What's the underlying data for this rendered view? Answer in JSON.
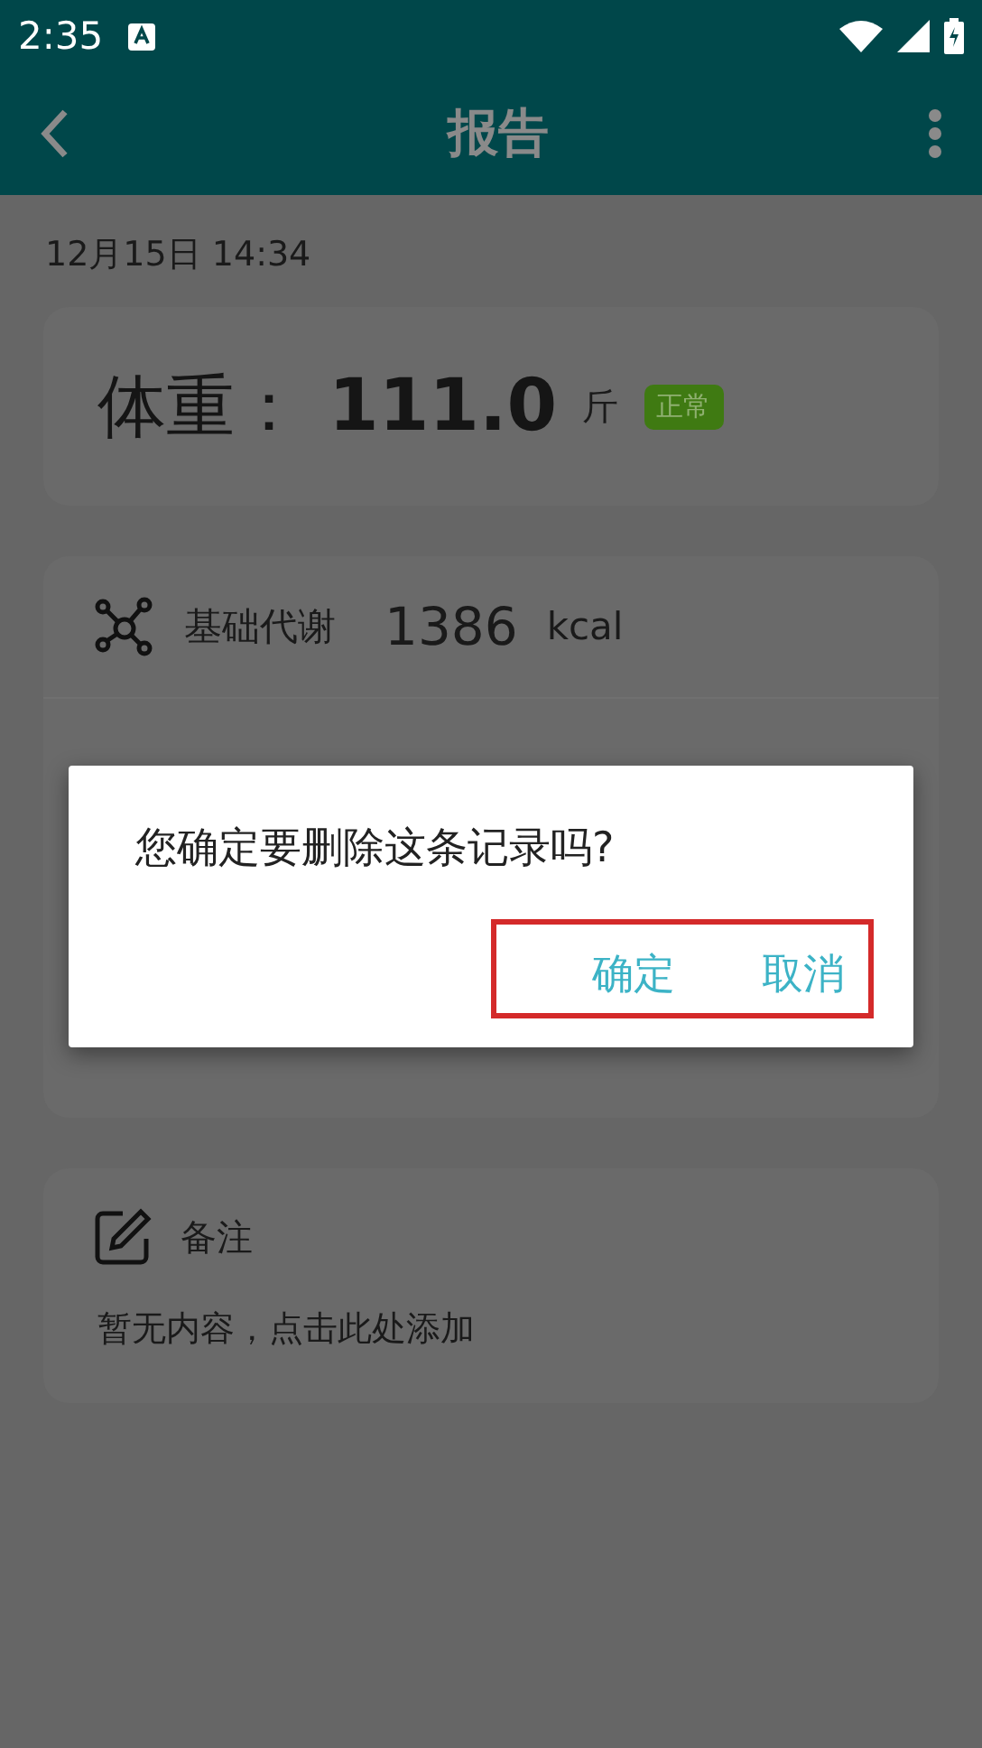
{
  "status_bar": {
    "time": "2:35"
  },
  "app_bar": {
    "title": "报告"
  },
  "date": "12月15日 14:34",
  "weight_card": {
    "label": "体重：",
    "value": "111.0",
    "unit": "斤",
    "badge": "正常"
  },
  "metrics": [
    {
      "kind": "bmr",
      "label": "基础代谢",
      "value": "1386",
      "unit": "kcal"
    }
  ],
  "note": {
    "title": "备注",
    "placeholder": "暂无内容，点击此处添加"
  },
  "dialog": {
    "message": "您确定要删除这条记录吗?",
    "buttons": [
      "确定",
      "取消"
    ]
  }
}
